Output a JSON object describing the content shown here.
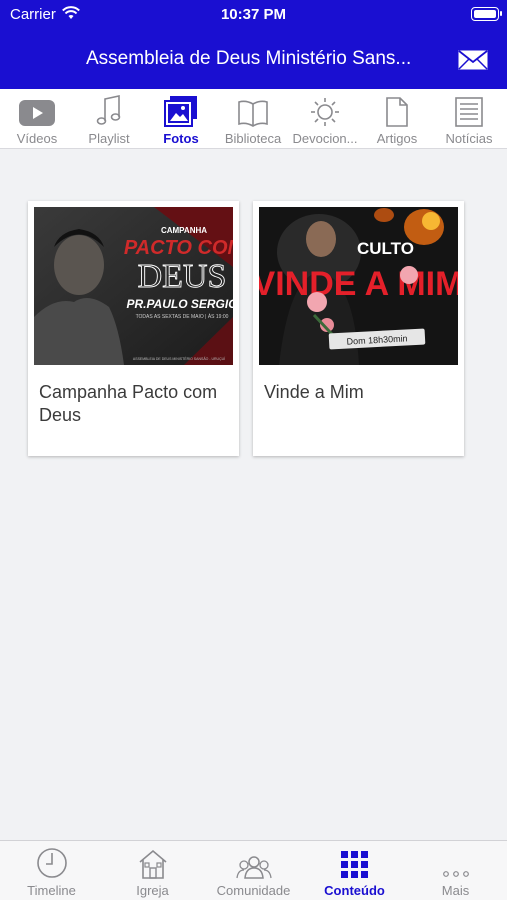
{
  "status_bar": {
    "carrier": "Carrier",
    "time": "10:37 PM"
  },
  "header": {
    "title": "Assembleia de Deus Ministério Sans..."
  },
  "tabs": [
    {
      "label": "Vídeos",
      "icon": "video-icon"
    },
    {
      "label": "Playlist",
      "icon": "music-note-icon"
    },
    {
      "label": "Fotos",
      "icon": "photos-icon",
      "active": true
    },
    {
      "label": "Biblioteca",
      "icon": "book-icon"
    },
    {
      "label": "Devocion...",
      "icon": "sun-icon"
    },
    {
      "label": "Artigos",
      "icon": "document-icon"
    },
    {
      "label": "Notícias",
      "icon": "newspaper-icon"
    }
  ],
  "albums": [
    {
      "title": "Campanha Pacto com Deus",
      "cover": {
        "line1": "CAMPANHA",
        "line2": "PACTO COM",
        "line3": "DEUS",
        "line4": "PR.PAULO SERGIO",
        "line5": "TODAS AS SEXTAS DE MAIO | ÀS 19:00",
        "line6": "ASSEMBLEIA DE DEUS MINISTÉRIO SANSÃO - URUÇUÍ"
      }
    },
    {
      "title": "Vinde a Mim",
      "cover": {
        "line1": "CULTO",
        "line2": "VINDE A MIM",
        "line3": "Dom 18h30min"
      }
    }
  ],
  "bottom_nav": [
    {
      "label": "Timeline",
      "icon": "clock-icon"
    },
    {
      "label": "Igreja",
      "icon": "church-icon"
    },
    {
      "label": "Comunidade",
      "icon": "people-icon"
    },
    {
      "label": "Conteúdo",
      "icon": "grid-icon",
      "active": true
    },
    {
      "label": "Mais",
      "icon": "more-icon"
    }
  ],
  "colors": {
    "brand": "#1a0fd1",
    "inactive": "#8a8a8e",
    "background": "#f1f2f4"
  }
}
